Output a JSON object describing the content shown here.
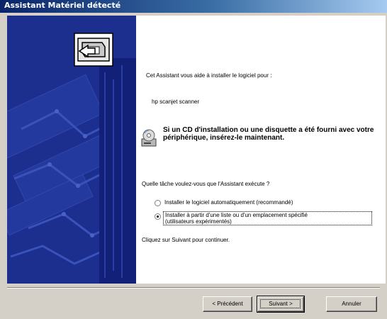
{
  "window": {
    "title": "Assistant Matériel détecté"
  },
  "content": {
    "intro": "Cet Assistant vous aide à installer le logiciel pour :",
    "device_name": "hp scanjet scanner",
    "cd_notice": "Si un CD d'installation ou une disquette a été fourni avec votre périphérique, insérez-le maintenant.",
    "question": "Quelle tâche voulez-vous que l'Assistant exécute ?",
    "options": [
      {
        "label": "Installer le logiciel automatiquement (recommandé)",
        "selected": false
      },
      {
        "label_line1": "Installer à partir d'une liste ou d'un emplacement spécifié",
        "label_line2": "(utilisateurs expérimentés)",
        "selected": true
      }
    ],
    "continue_hint": "Cliquez sur Suivant pour continuer."
  },
  "buttons": {
    "back": "< Précédent",
    "next": "Suivant >",
    "cancel": "Annuler"
  },
  "icons": {
    "wizard": "hardware-wizard-icon",
    "cd": "cd-drive-icon"
  },
  "colors": {
    "titlebar_start": "#0a246a",
    "side_panel": "#1a2c8c",
    "dialog_face": "#d4d0c8"
  }
}
